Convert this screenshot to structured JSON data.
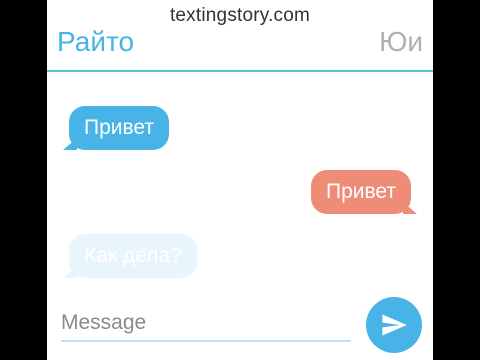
{
  "watermark": "textingstory.com",
  "header": {
    "contact_left": "Райто",
    "contact_right": "Юи"
  },
  "messages": [
    {
      "side": "left",
      "text": "Привет"
    },
    {
      "side": "right",
      "text": "Привет"
    },
    {
      "side": "left",
      "text": "Как дела?",
      "state": "appearing"
    }
  ],
  "composer": {
    "placeholder": "Message",
    "send_icon": "send-icon"
  },
  "colors": {
    "accent": "#48b3e6",
    "outgoing_bubble": "#ef8c77",
    "incoming_bubble": "#48b3e6"
  }
}
